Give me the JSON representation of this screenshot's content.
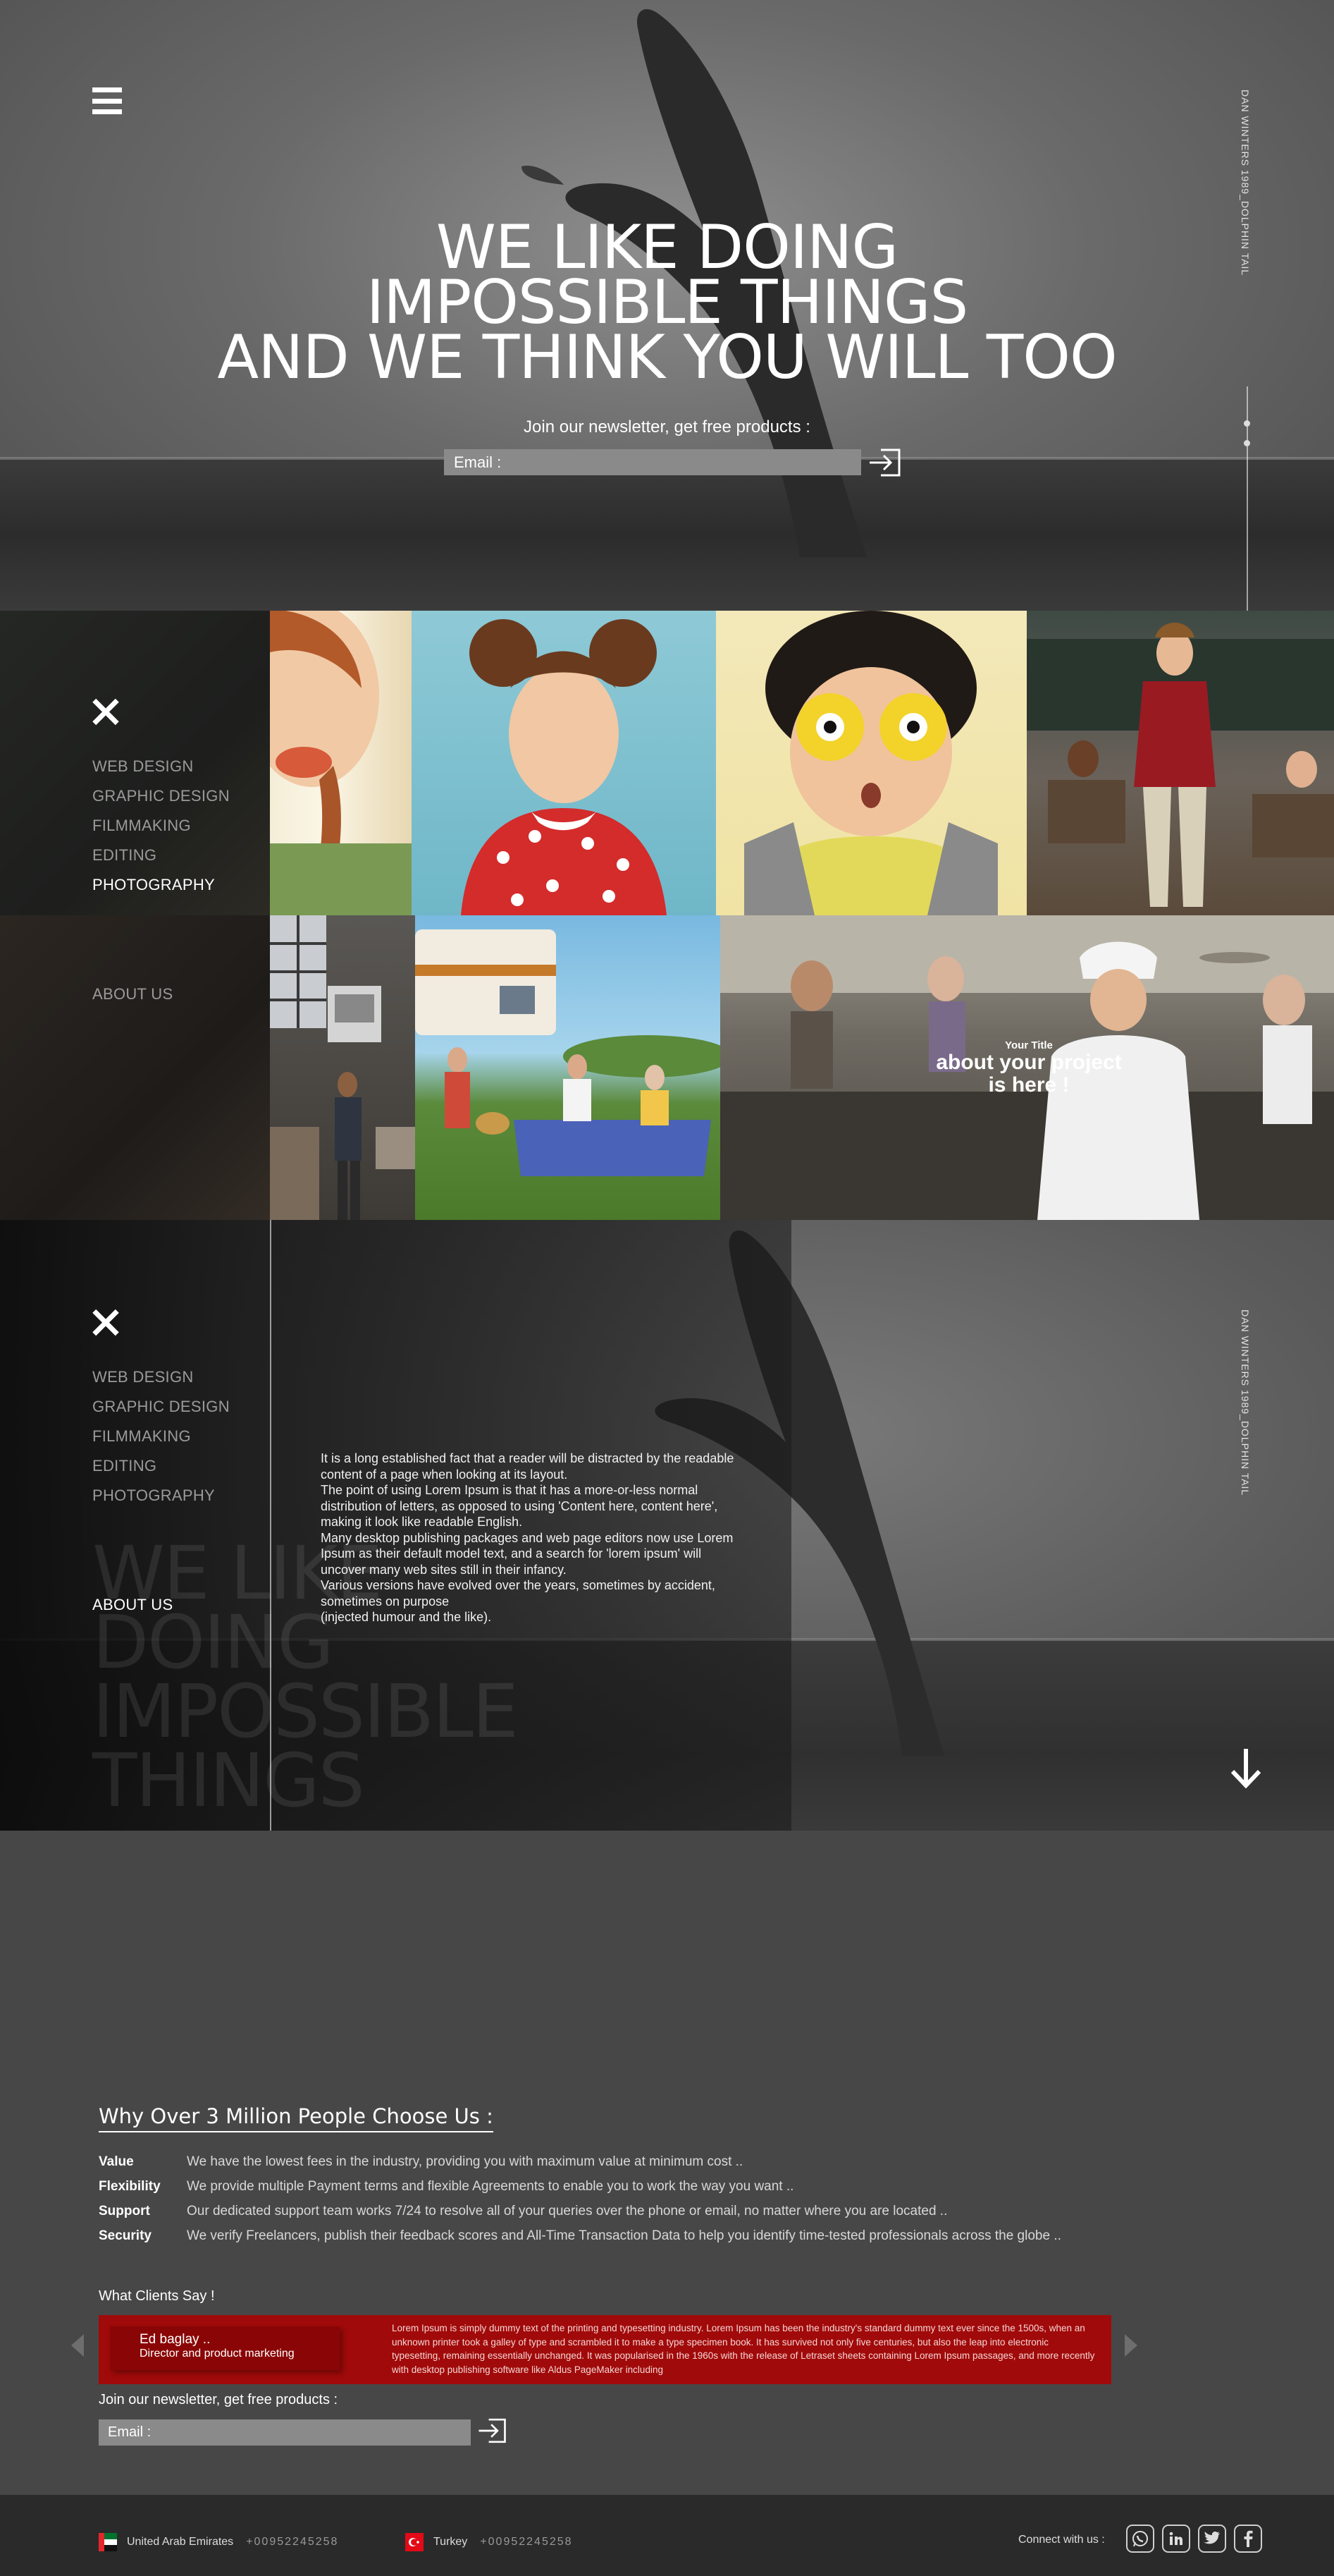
{
  "hero": {
    "title_lines": [
      "WE LIKE DOING",
      "IMPOSSIBLE THINGS",
      "AND WE THINK YOU WILL TOO"
    ],
    "credit": "DAN WINTERS 1989_DOLPHIN TAIL",
    "newsletter_text": "Join our newsletter, get free products :",
    "email_placeholder": "Email :"
  },
  "menu": {
    "items": [
      "WEB DESIGN",
      "GRAPHIC DESIGN",
      "FILMMAKING",
      "EDITING",
      "PHOTOGRAPHY"
    ],
    "about": "ABOUT US",
    "active": "PHOTOGRAPHY"
  },
  "project": {
    "small_title": "Your Title",
    "big_title_1": "about your project",
    "big_title_2": "is here !"
  },
  "about": {
    "credit": "DAN WINTERS 1989_DOLPHIN TAIL",
    "bg_lines": [
      "WE LIKE",
      "DOING",
      "IMPOSSIBLE",
      "THINGS"
    ],
    "paragraphs": [
      "It is a long established fact that a reader will be distracted by the readable content of a page when looking at its layout.",
      "The point of using Lorem Ipsum is that it has a more-or-less normal distribution of letters, as opposed to using 'Content here, content here', making it look like readable English.",
      "Many desktop publishing packages and web page editors now use Lorem Ipsum as their default model text, and a search for 'lorem ipsum' will uncover many web sites still in their infancy.",
      "Various versions have evolved over the years, sometimes by accident, sometimes on purpose",
      "(injected humour and the like)."
    ]
  },
  "why": {
    "title": "Why Over 3 Million People Choose Us :",
    "features": [
      {
        "key": "Value",
        "text": "We have the lowest fees in the industry, providing you with maximum value at minimum cost .."
      },
      {
        "key": "Flexibility",
        "text": "We provide multiple Payment terms and flexible Agreements to enable you to work the way you want .."
      },
      {
        "key": "Support",
        "text": "Our dedicated support team works 7/24 to resolve all of your queries over the phone or email, no matter where you are located .."
      },
      {
        "key": "Security",
        "text": "We verify Freelancers, publish their feedback scores and All-Time Transaction Data to help you identify time-tested professionals across the globe .."
      }
    ]
  },
  "clients": {
    "title": "What Clients Say !",
    "name": "Ed baglay ..",
    "role": "Director and product marketing",
    "quote": "Lorem Ipsum is simply dummy text of the printing and typesetting industry. Lorem Ipsum has been the industry's standard dummy text ever since the 1500s, when an unknown printer took a galley of type and scrambled it to make a type specimen book. It has survived not only five centuries, but also the leap into electronic typesetting, remaining essentially unchanged. It was popularised in the 1960s with the release of Letraset sheets containing Lorem Ipsum passages, and more recently with desktop publishing software like Aldus PageMaker including"
  },
  "newsletter2": {
    "text": "Join our newsletter, get free products :",
    "email_placeholder": "Email :"
  },
  "footer": {
    "loc1_country": "United Arab Emirates",
    "loc1_phone": "+00952245258",
    "loc2_country": "Turkey",
    "loc2_phone": "+00952245258",
    "connect": "Connect with us :",
    "socials": [
      "whatsapp-icon",
      "linkedin-icon",
      "twitter-icon",
      "facebook-icon"
    ]
  },
  "colors": {
    "accent_red": "#a10a0a",
    "footer_bg": "#2a2a2a",
    "body_bg": "#474747"
  }
}
